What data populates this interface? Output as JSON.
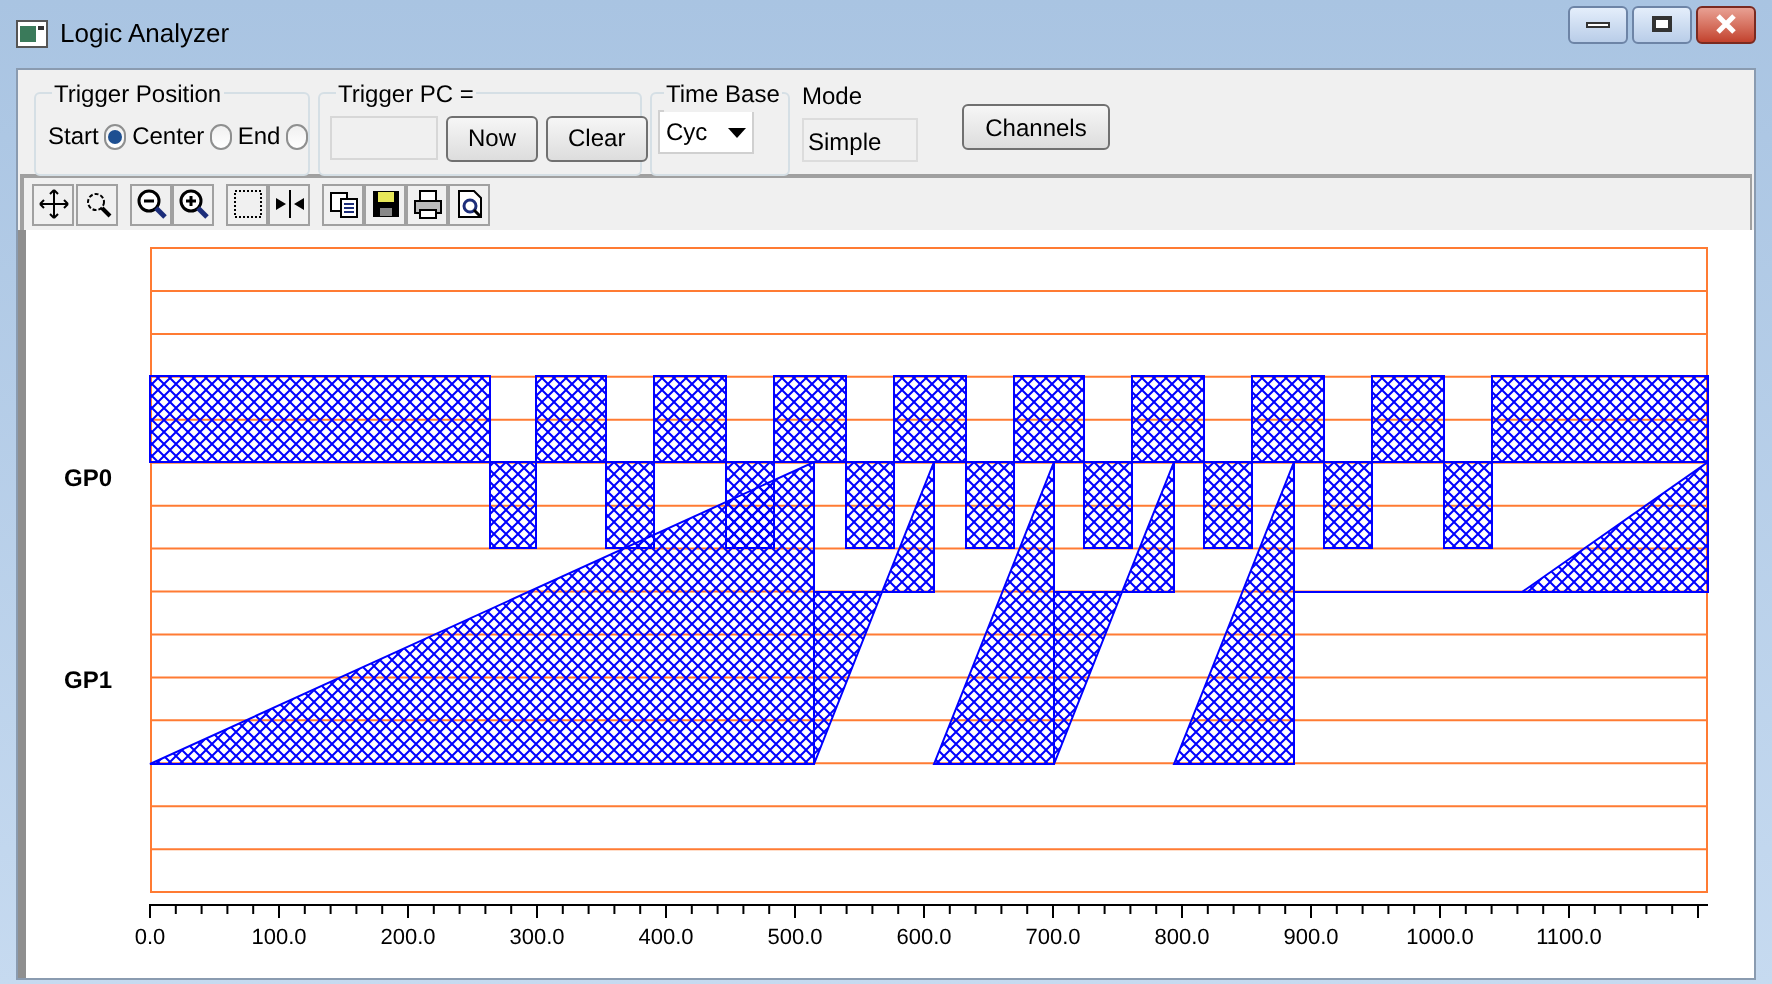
{
  "window": {
    "title": "Logic Analyzer"
  },
  "trigger_position": {
    "label": "Trigger Position",
    "options": [
      {
        "label": "Start",
        "selected": true
      },
      {
        "label": "Center",
        "selected": false
      },
      {
        "label": "End",
        "selected": false
      }
    ]
  },
  "trigger_pc": {
    "label": "Trigger PC =",
    "buttons": [
      "Now",
      "Clear"
    ]
  },
  "time_base": {
    "label": "Time Base",
    "value": "Cyc"
  },
  "mode": {
    "label": "Mode",
    "value": "Simple"
  },
  "channels_button": "Channels",
  "plot": {
    "channels": [
      {
        "name": "GP0"
      },
      {
        "name": "GP1"
      }
    ],
    "x_labels": [
      "0.0",
      "100.0",
      "200.0",
      "300.0",
      "400.0",
      "500.0",
      "600.0",
      "700.0",
      "800.0",
      "900.0",
      "1000.0",
      "1100.0"
    ]
  }
}
